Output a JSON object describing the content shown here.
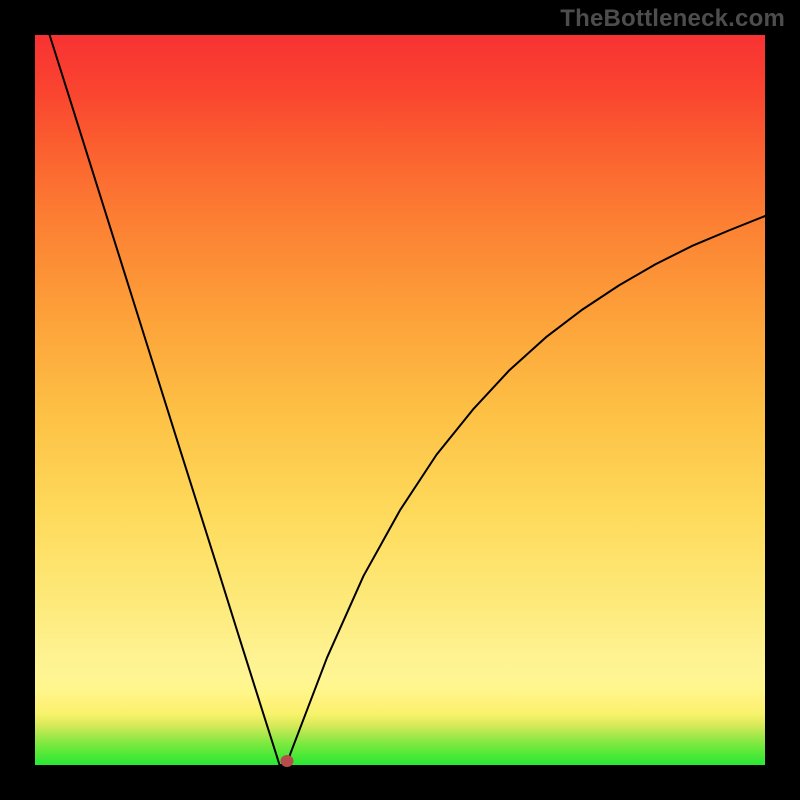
{
  "watermark": "TheBottleneck.com",
  "colors": {
    "background": "#000000",
    "curve": "#000000",
    "dot": "#b84b4b"
  },
  "chart_data": {
    "type": "line",
    "title": "",
    "xlabel": "",
    "ylabel": "",
    "xlim": [
      0,
      1
    ],
    "ylim": [
      0,
      1
    ],
    "series": [
      {
        "name": "bottleneck-curve",
        "x": [
          0.02,
          0.05,
          0.1,
          0.15,
          0.2,
          0.25,
          0.28,
          0.31,
          0.33,
          0.335,
          0.34,
          0.345,
          0.35,
          0.4,
          0.45,
          0.5,
          0.55,
          0.6,
          0.65,
          0.7,
          0.75,
          0.8,
          0.85,
          0.9,
          0.95,
          1.0
        ],
        "y": [
          1.0,
          0.905,
          0.746,
          0.587,
          0.428,
          0.27,
          0.174,
          0.079,
          0.016,
          0.0,
          0.0,
          0.0,
          0.016,
          0.147,
          0.259,
          0.349,
          0.425,
          0.487,
          0.541,
          0.586,
          0.624,
          0.657,
          0.686,
          0.711,
          0.732,
          0.752
        ]
      }
    ],
    "marker": {
      "x": 0.345,
      "y": 0.005
    },
    "background_gradient": {
      "direction": "vertical",
      "stops": [
        {
          "pos": 0.0,
          "color": "#27e833"
        },
        {
          "pos": 0.07,
          "color": "#f7f36b"
        },
        {
          "pos": 0.15,
          "color": "#fef291"
        },
        {
          "pos": 0.5,
          "color": "#fdb840"
        },
        {
          "pos": 0.85,
          "color": "#fb5e2f"
        },
        {
          "pos": 1.0,
          "color": "#f83232"
        }
      ]
    }
  }
}
